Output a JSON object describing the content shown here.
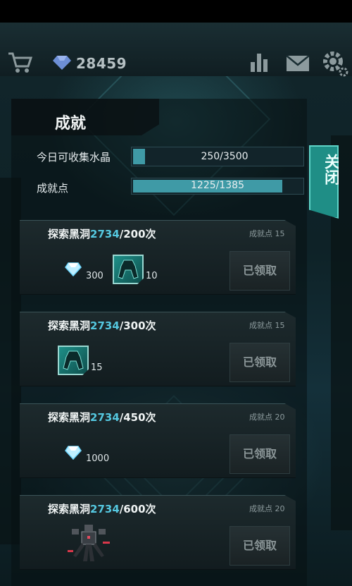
{
  "top": {
    "crystal_count": "28459",
    "icons": [
      "cart-icon",
      "crystal-icon",
      "ranking-icon",
      "mail-icon",
      "settings-icon"
    ]
  },
  "panel": {
    "title": "成就",
    "close_label": "关闭",
    "stats": {
      "crystal_label": "今日可收集水晶",
      "crystal_value": "250/3500",
      "crystal_progress": 0.071,
      "points_label": "成就点",
      "points_value": "1225/1385",
      "points_progress": 0.885
    }
  },
  "achievements": [
    {
      "prefix": "探索黑洞",
      "current": "2734",
      "target": "/200次",
      "points": "成就点 15",
      "button": "已领取",
      "rewards": [
        {
          "type": "crystal",
          "amount": "300"
        },
        {
          "type": "mech",
          "amount": "10"
        }
      ]
    },
    {
      "prefix": "探索黑洞",
      "current": "2734",
      "target": "/300次",
      "points": "成就点 15",
      "button": "已领取",
      "rewards": [
        {
          "type": "mech",
          "amount": "15"
        }
      ]
    },
    {
      "prefix": "探索黑洞",
      "current": "2734",
      "target": "/450次",
      "points": "成就点 20",
      "button": "已领取",
      "rewards": [
        {
          "type": "crystal",
          "amount": "1000"
        }
      ]
    },
    {
      "prefix": "探索黑洞",
      "current": "2734",
      "target": "/600次",
      "points": "成就点 20",
      "button": "已领取",
      "rewards": [
        {
          "type": "robot",
          "amount": ""
        }
      ]
    }
  ],
  "colors": {
    "accent": "#55c8e0",
    "tab": "#1f8e86",
    "bar_fill": "#3f9aa6"
  }
}
